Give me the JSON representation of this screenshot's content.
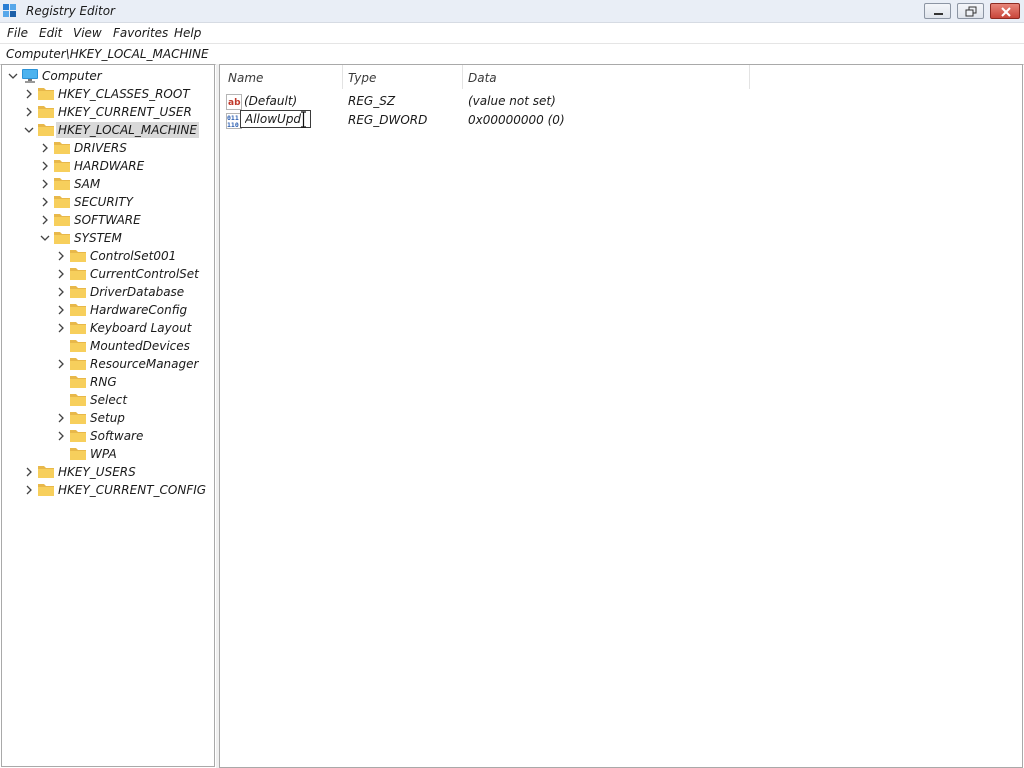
{
  "window": {
    "title": "Registry Editor",
    "icon": "registry-editor-icon",
    "controls": [
      "minimize",
      "restore",
      "close"
    ]
  },
  "menu": [
    "File",
    "Edit",
    "View",
    "Favorites",
    "Help"
  ],
  "address": "Computer\\HKEY_LOCAL_MACHINE",
  "tree": {
    "root": "Computer",
    "hives": [
      "HKEY_CLASSES_ROOT",
      "HKEY_CURRENT_USER",
      "HKEY_LOCAL_MACHINE",
      "HKEY_USERS",
      "HKEY_CURRENT_CONFIG"
    ],
    "hklm_children": [
      "DRIVERS",
      "HARDWARE",
      "SAM",
      "SECURITY",
      "SOFTWARE",
      "SYSTEM"
    ],
    "system_children": [
      "ControlSet001",
      "CurrentControlSet",
      "DriverDatabase",
      "HardwareConfig",
      "Keyboard Layout",
      "MountedDevices",
      "ResourceManager",
      "RNG",
      "Select",
      "Setup",
      "Software",
      "WPA"
    ],
    "selected": "HKEY_LOCAL_MACHINE"
  },
  "columns": {
    "name": "Name",
    "type": "Type",
    "data": "Data"
  },
  "values": [
    {
      "name": "(Default)",
      "type": "REG_SZ",
      "data": "(value not set)",
      "icon": "string-value-icon"
    },
    {
      "name": "AllowUpd",
      "type": "REG_DWORD",
      "data": "0x00000000 (0)",
      "icon": "binary-value-icon",
      "editing": true
    }
  ]
}
